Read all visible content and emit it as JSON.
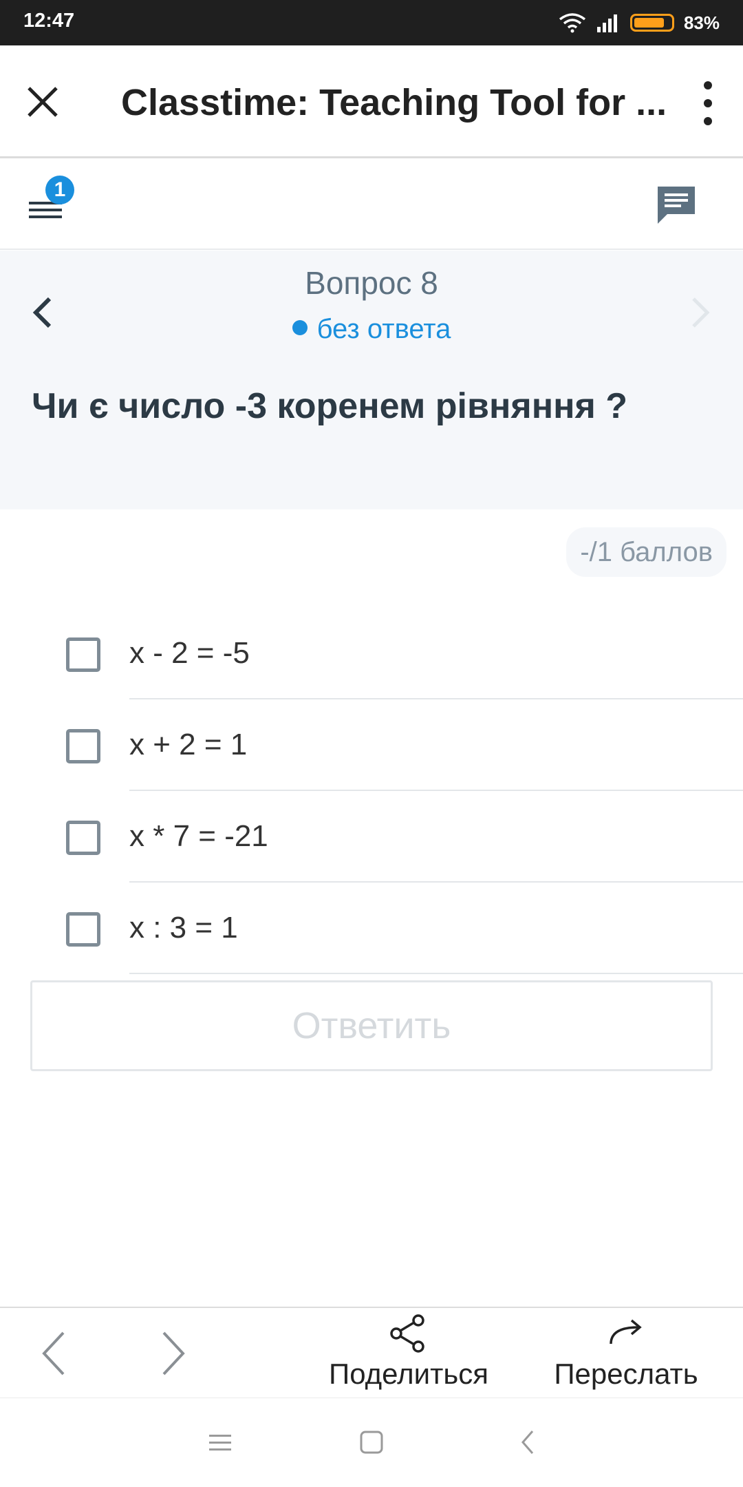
{
  "status_bar": {
    "time": "12:47",
    "battery_percent": "83%",
    "battery_level": 0.83,
    "icons": [
      "wifi-icon",
      "signal-icon",
      "battery-icon"
    ]
  },
  "app_bar": {
    "title": "Classtime: Teaching Tool for ...",
    "close_icon": "close-icon",
    "more_icon": "more-vert-icon"
  },
  "toolbar": {
    "badge_count": "1",
    "menu_icon": "menu-list-icon",
    "chat_icon": "chat-icon"
  },
  "question": {
    "number_label": "Вопрос 8",
    "status": "без ответа",
    "text": "Чи є число -3 коренем рівняння ?",
    "points": "-/1 баллов"
  },
  "answers": [
    {
      "label": "x - 2 = -5",
      "checked": false
    },
    {
      "label": "x + 2 = 1",
      "checked": false
    },
    {
      "label": "x * 7 = -21",
      "checked": false
    },
    {
      "label": "x : 3 = 1",
      "checked": false
    }
  ],
  "submit_label": "Ответить",
  "bottom_nav": {
    "share_label": "Поделиться",
    "forward_label": "Переслать"
  },
  "colors": {
    "accent": "#1a8fdd",
    "question_bg": "#f5f7fa",
    "battery": "#ff9f1a"
  }
}
